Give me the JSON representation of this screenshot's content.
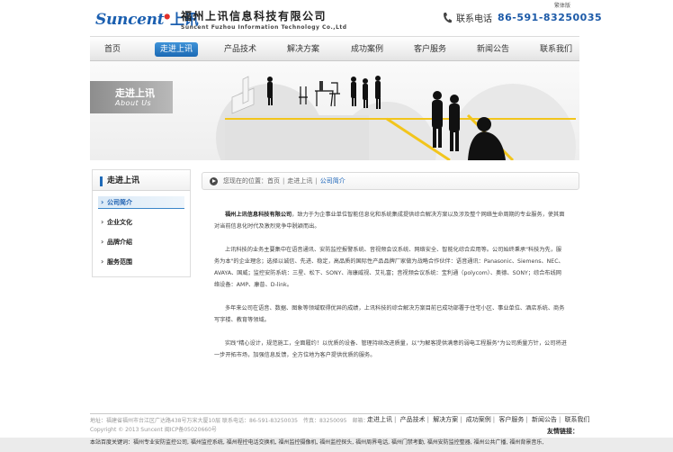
{
  "header": {
    "logo_en": "Suncent",
    "logo_cn": "上讯",
    "company_cn": "福州上讯信息科技有限公司",
    "company_en": "Suncent Fuzhou Information Technology Co.,Ltd",
    "top_link": "繁体版",
    "hotline_label": "联系电话",
    "hotline_number": "86-591-83250035",
    "brand_color": "#1b5fb0"
  },
  "nav": {
    "items": [
      {
        "label": "首页"
      },
      {
        "label": "走进上讯"
      },
      {
        "label": "产品技术"
      },
      {
        "label": "解决方案"
      },
      {
        "label": "成功案例"
      },
      {
        "label": "客户服务"
      },
      {
        "label": "新闻公告"
      },
      {
        "label": "联系我们"
      }
    ],
    "active_label": "走进上讯"
  },
  "banner": {
    "title": "走进上讯",
    "subtitle": "About Us"
  },
  "sidebar": {
    "title": "走进上讯",
    "items": [
      {
        "label": "公司简介"
      },
      {
        "label": "企业文化"
      },
      {
        "label": "品牌介绍"
      },
      {
        "label": "服务范围"
      }
    ],
    "active_label": "公司简介"
  },
  "breadcrumb": {
    "prefix": "您现在的位置：",
    "home": "首页",
    "section": "走进上讯",
    "current": "公司简介"
  },
  "content": {
    "p1_company": "福州上讯信息科技有限公司",
    "p1_rest": "，致力于为企事业单位智能信息化和系统集成提供综合解决方案以及涉及整个网络生命周期的专业服务，使其面对当前信息化时代及激烈竞争中脱颖而出。",
    "p2": "上讯科技的业务主要集中在语音通讯、安防监控报警系统、音视频会议系统、网络安全、智能化综合应用等。公司始终秉承\"科技为先，服务为本\"的企业理念；选择以诚信、先进、稳定，高品质的国际性产品品牌厂家做为战略合作伙伴：语音通讯：Panasonic、Siemens、NEC、AVAYA、国威；监控安防系统：三星、松下、SONY、海康威视、艾礼富；音视频会议系统：宝利通（polycom）、奥德、SONY；综合布线网络设备：AMP、康普、D-link。",
    "p3": "多年来公司在语音、数据、图象等领域取得优异的成绩，上讯科技的综合解决方案目前已成功部署于住宅小区、事业单位、酒店系统、商务写字楼、教育等领域。",
    "p4": "实践\"精心设计，规范施工，全面履约！以优质的设备、管理持续改进质量，以\"为解客提供满意的弱电工程服务\"为公司质量方针，公司将进一步开拓市场，加强信息反馈，全方位地为客户提供优质的服务。"
  },
  "footer": {
    "info": "地址：福建省福州市台江区广达路438号万宋大厦10层 联系电话：86-591-83250035　传真：83250095　邮箱：",
    "copyright": "Copyright © 2013 Suncent 闽ICP备05020660号",
    "links": [
      {
        "label": "走进上讯"
      },
      {
        "label": "产品技术"
      },
      {
        "label": "解决方案"
      },
      {
        "label": "成功案例"
      },
      {
        "label": "客户服务"
      },
      {
        "label": "新闻公告"
      },
      {
        "label": "联系我们"
      }
    ],
    "link_separator": "|",
    "friend_links_label": "友情链接：",
    "keywords": "本站百度关键词：福州专业安防监控公司, 福州监控系统, 福州程控电话交换机, 福州监控摄像机, 福州监控探头, 福州周界电话, 福州门禁考勤, 福州安防监控整器, 福州公共广播, 福州背景音乐,"
  }
}
